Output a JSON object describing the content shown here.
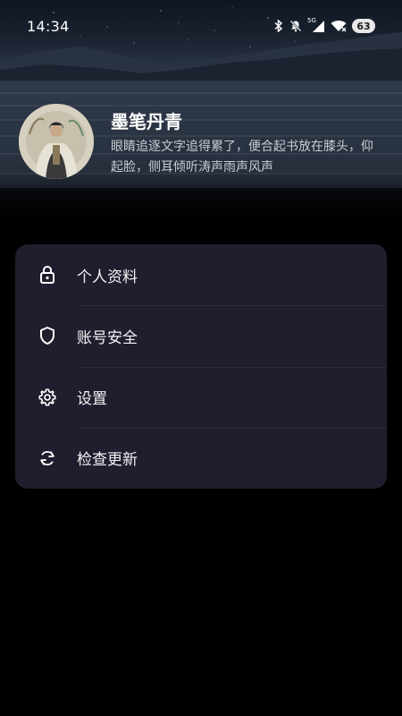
{
  "status_bar": {
    "time": "14:34",
    "network_label": "5G",
    "battery": "63"
  },
  "profile": {
    "name": "墨笔丹青",
    "bio": "眼睛追逐文字追得累了，便合起书放在膝头，仰起脸，侧耳倾听涛声雨声风声"
  },
  "menu": {
    "items": [
      {
        "label": "个人资料",
        "icon": "lock-icon"
      },
      {
        "label": "账号安全",
        "icon": "shield-icon"
      },
      {
        "label": "设置",
        "icon": "gear-icon"
      },
      {
        "label": "检查更新",
        "icon": "refresh-icon"
      }
    ]
  },
  "colors": {
    "page_background": "#000000",
    "card_background": "#1e1e2e",
    "divider": "#2c2c3d",
    "text_primary": "#f2f2f5",
    "text_secondary": "#c9ccd2"
  }
}
